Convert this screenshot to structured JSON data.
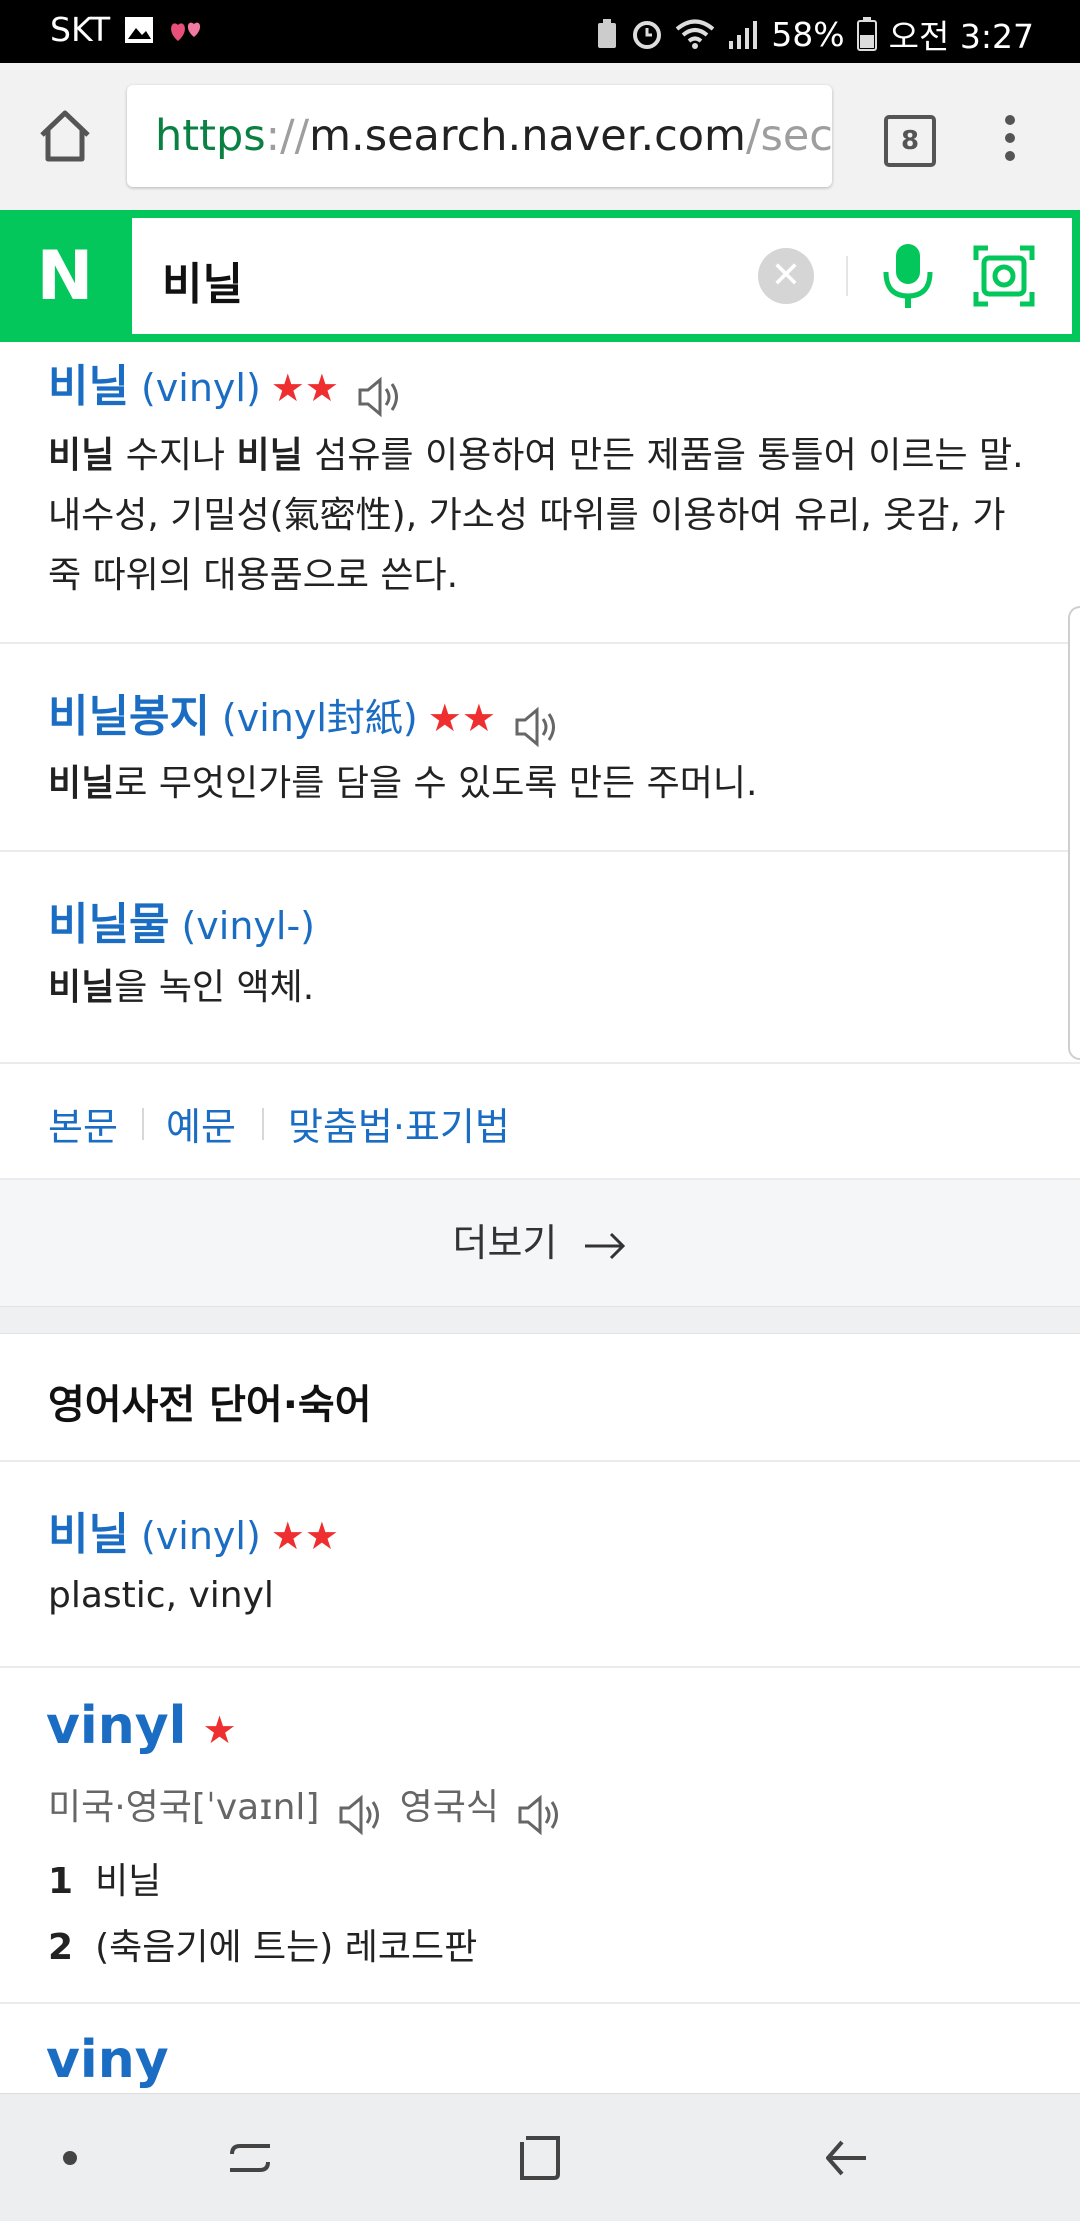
{
  "status_bar": {
    "carrier": "SKT",
    "battery": "58%",
    "time": "오전 3:27"
  },
  "browser": {
    "url_scheme": "https",
    "url_sep": "://",
    "url_host": "m.search.naver.com",
    "url_rest": "/sec",
    "tab_count": "8"
  },
  "naver": {
    "logo": "N",
    "query": "비닐",
    "clear_icon": "✕",
    "accent": "#03c75a"
  },
  "kr_dict": {
    "entries": [
      {
        "headword": "비닐",
        "origin": "(vinyl)",
        "stars": "★★",
        "definition_parts": [
          "비닐",
          " 수지나 ",
          "비닐",
          " 섬유를 이용하여 만든 제품을 통틀어 이르는 말. 내수성, 기밀성(氣密性), 가소성 따위를 이용하여 유리, 옷감, 가죽 따위의 대용품으로 쓴다."
        ]
      },
      {
        "headword": "비닐봉지",
        "origin": "(vinyl封紙)",
        "stars": "★★",
        "definition_parts": [
          "비닐",
          "로 무엇인가를 담을 수 있도록 만든 주머니."
        ]
      },
      {
        "headword": "비닐물",
        "origin": "(vinyl-)",
        "definition_parts": [
          "비닐",
          "을 녹인 액체."
        ]
      }
    ],
    "links": [
      "본문",
      "예문",
      "맞춤법·표기법"
    ],
    "more_label": "더보기"
  },
  "en_dict": {
    "section_title": "영어사전 단어·숙어",
    "entries": [
      {
        "headword": "비닐",
        "origin": "(vinyl)",
        "stars": "★★",
        "meaning": "plastic, vinyl"
      },
      {
        "headword": "vinyl",
        "stars": "★",
        "pron_us_uk": "미국·영국[ˈvaɪnl]",
        "pron_uk": "영국식",
        "senses": [
          {
            "num": "1",
            "text": "비닐"
          },
          {
            "num": "2",
            "text": "(축음기에 트는) 레코드판"
          }
        ]
      },
      {
        "headword": "viny"
      }
    ]
  },
  "colors": {
    "link_blue": "#1a6dc2",
    "star_red": "#ef2f2f"
  }
}
